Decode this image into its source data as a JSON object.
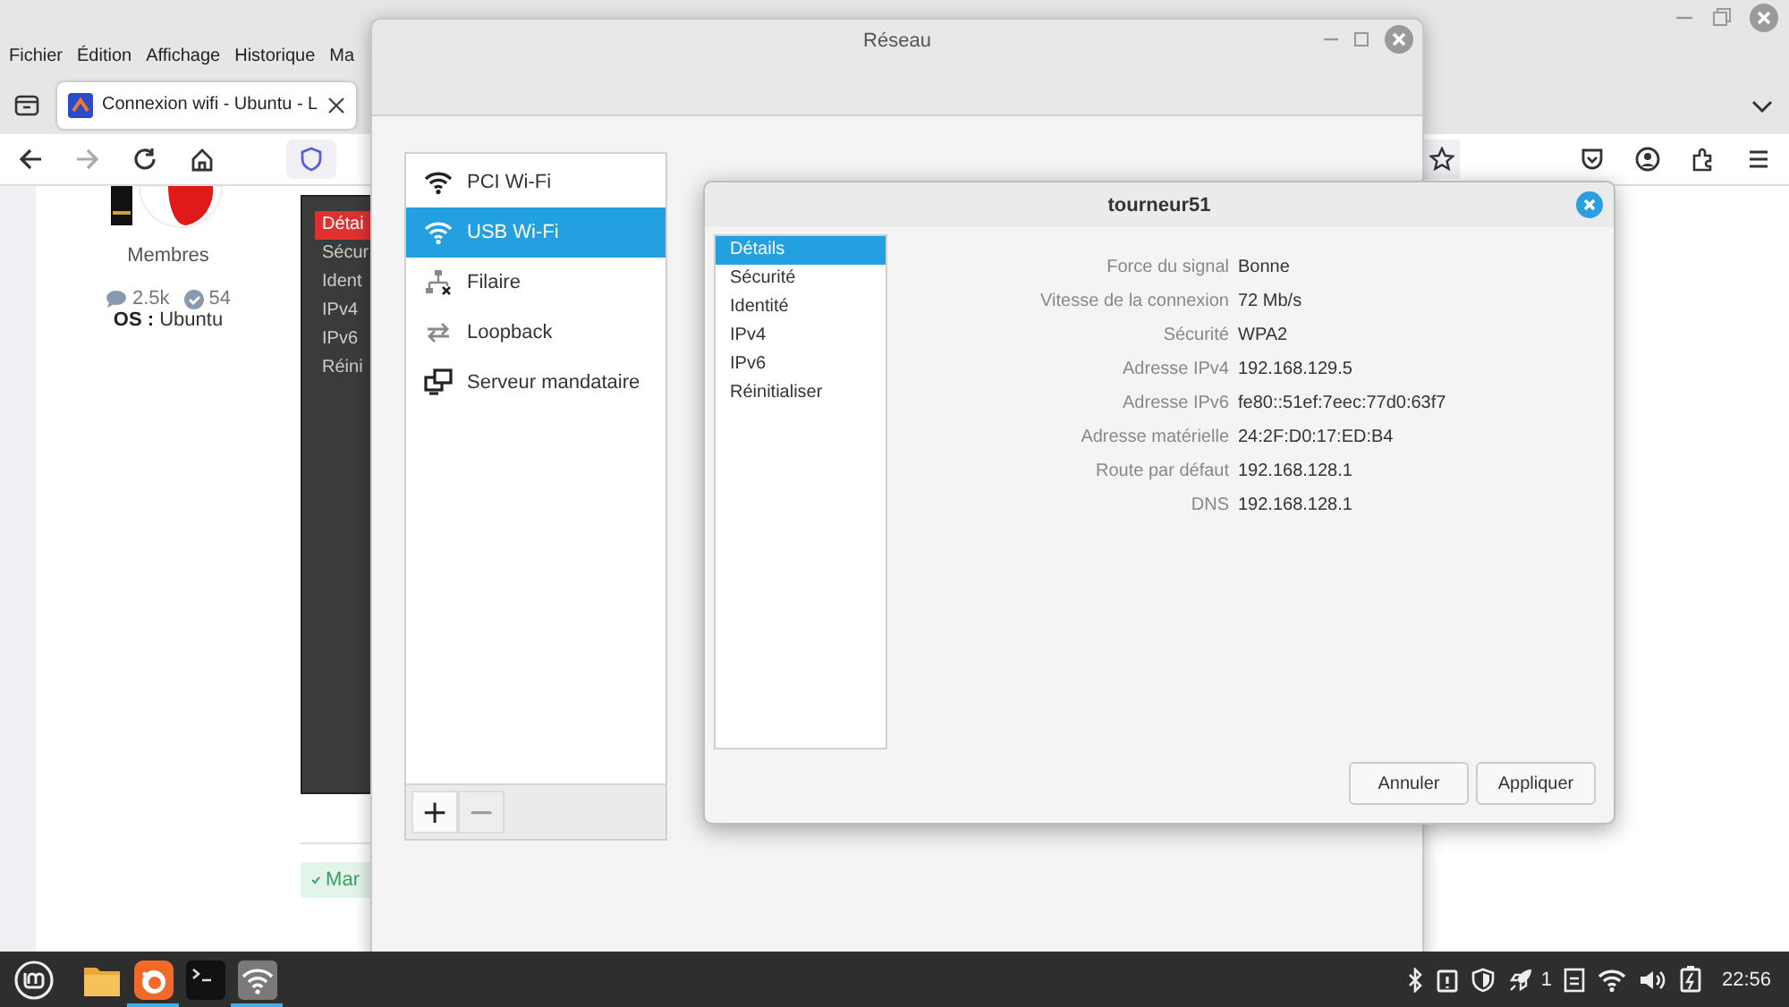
{
  "browser": {
    "menu": [
      "Fichier",
      "Édition",
      "Affichage",
      "Historique",
      "Ma"
    ],
    "tab": {
      "title": "Connexion wifi - Ubuntu - L",
      "selected": true
    },
    "nav": [
      {
        "kind": "back",
        "disabled": false
      },
      {
        "kind": "forward",
        "disabled": true
      },
      {
        "kind": "reload",
        "disabled": false
      },
      {
        "kind": "home",
        "disabled": false
      }
    ],
    "toolbar": [
      {
        "kind": "pocket"
      },
      {
        "kind": "account"
      },
      {
        "kind": "extensions"
      },
      {
        "kind": "menu"
      }
    ]
  },
  "page": {
    "role": "Membres",
    "posts": "2.5k",
    "reputation": "54",
    "os_label": "OS :",
    "os_value": "Ubuntu",
    "screenshot_items": [
      {
        "label": "Détai",
        "selected": true
      },
      {
        "label": "Sécur",
        "selected": false
      },
      {
        "label": "Ident",
        "selected": false
      },
      {
        "label": "IPv4",
        "selected": false
      },
      {
        "label": "IPv6",
        "selected": false
      },
      {
        "label": "Réini",
        "selected": false
      }
    ],
    "solution_button": "Mar"
  },
  "network_window": {
    "title": "Réseau",
    "devices": [
      {
        "kind": "wifi",
        "label": "PCI Wi-Fi",
        "selected": false
      },
      {
        "kind": "wifi",
        "label": "USB Wi-Fi",
        "selected": true
      },
      {
        "kind": "wired",
        "label": "Filaire",
        "selected": false
      },
      {
        "kind": "loopback",
        "label": "Loopback",
        "selected": false
      },
      {
        "kind": "proxy",
        "label": "Serveur mandataire",
        "selected": false
      }
    ],
    "add": {
      "label": "+",
      "disabled": false
    },
    "remove": {
      "label": "−",
      "disabled": true
    }
  },
  "dialog": {
    "title": "tourneur51",
    "sections": [
      {
        "label": "Détails",
        "selected": true
      },
      {
        "label": "Sécurité",
        "selected": false
      },
      {
        "label": "Identité",
        "selected": false
      },
      {
        "label": "IPv4",
        "selected": false
      },
      {
        "label": "IPv6",
        "selected": false
      },
      {
        "label": "Réinitialiser",
        "selected": false
      }
    ],
    "details": [
      {
        "label": "Force du signal",
        "value": "Bonne"
      },
      {
        "label": "Vitesse de la connexion",
        "value": "72 Mb/s"
      },
      {
        "label": "Sécurité",
        "value": "WPA2"
      },
      {
        "label": "Adresse IPv4",
        "value": "192.168.129.5"
      },
      {
        "label": "Adresse IPv6",
        "value": "fe80::51ef:7eec:77d0:63f7"
      },
      {
        "label": "Adresse matérielle",
        "value": "24:2F:D0:17:ED:B4"
      },
      {
        "label": "Route par défaut",
        "value": "192.168.128.1"
      },
      {
        "label": "DNS",
        "value": "192.168.128.1"
      }
    ],
    "buttons": [
      "Annuler",
      "Appliquer"
    ]
  },
  "taskbar": {
    "apps": [
      {
        "kind": "files",
        "running": false
      },
      {
        "kind": "firefox",
        "running": true
      },
      {
        "kind": "terminal",
        "running": false
      },
      {
        "kind": "network",
        "running": true
      }
    ],
    "tray": [
      {
        "kind": "bluetooth"
      },
      {
        "kind": "clipboard"
      },
      {
        "kind": "shield"
      },
      {
        "kind": "rocket",
        "count": "1"
      },
      {
        "kind": "note"
      },
      {
        "kind": "wifi"
      },
      {
        "kind": "volume"
      },
      {
        "kind": "battery"
      }
    ],
    "clock": "22:56"
  }
}
